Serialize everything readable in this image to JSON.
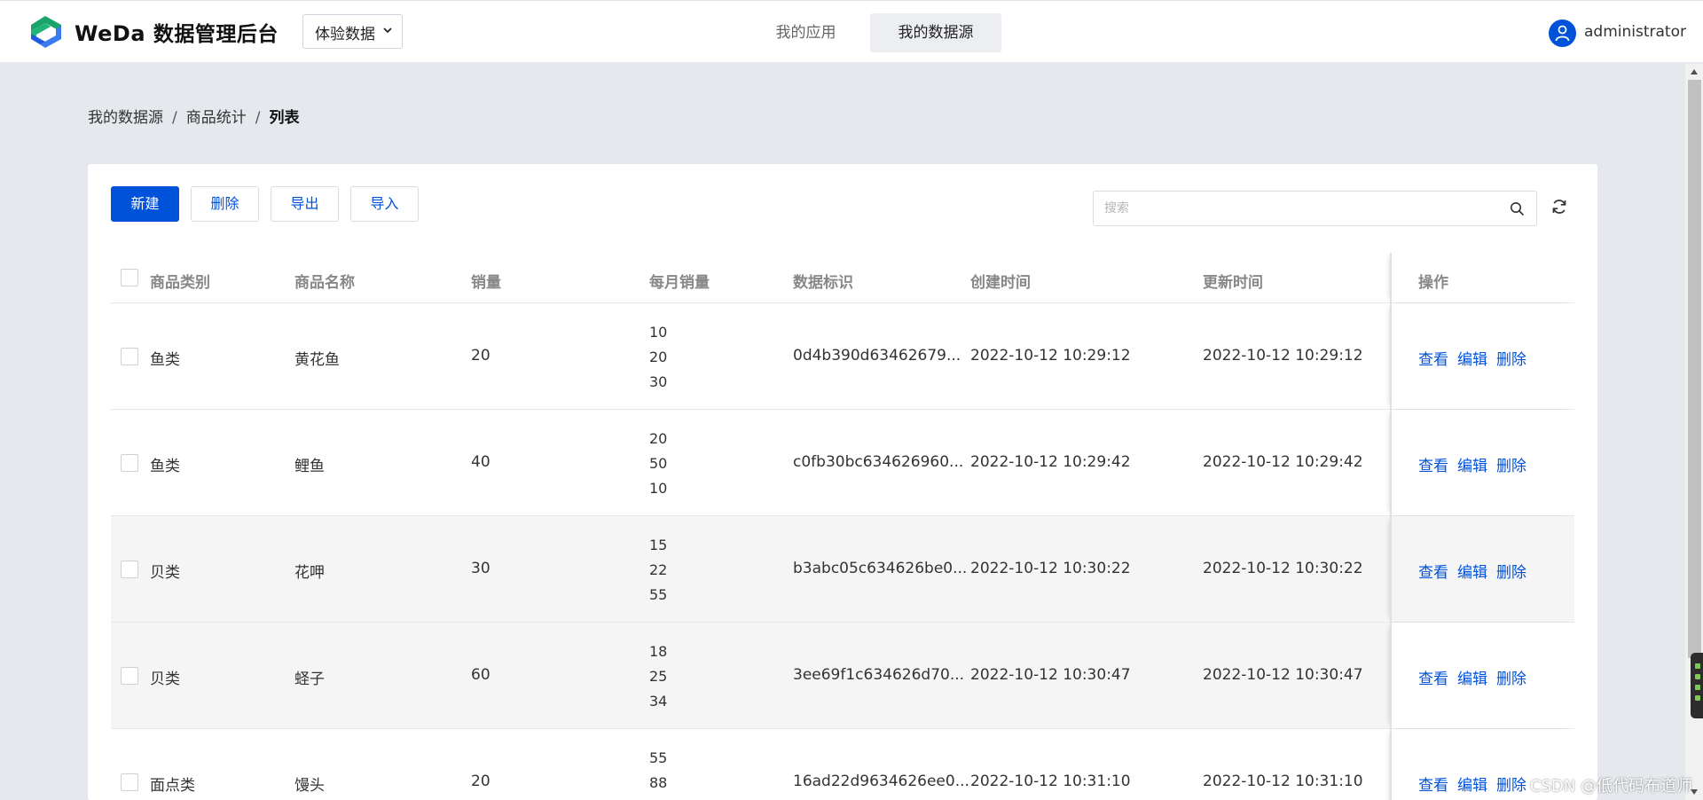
{
  "header": {
    "brand": "WeDa",
    "brand_sub": "数据管理后台",
    "env_select": "体验数据",
    "tabs": [
      {
        "label": "我的应用",
        "active": false
      },
      {
        "label": "我的数据源",
        "active": true
      }
    ],
    "user": "administrator"
  },
  "breadcrumb": [
    "我的数据源",
    "商品统计",
    "列表"
  ],
  "toolbar": {
    "new_label": "新建",
    "delete_label": "删除",
    "export_label": "导出",
    "import_label": "导入",
    "search_placeholder": "搜索"
  },
  "table": {
    "columns": [
      "商品类别",
      "商品名称",
      "销量",
      "每月销量",
      "数据标识",
      "创建时间",
      "更新时间",
      "操作"
    ],
    "rows": [
      {
        "category": "鱼类",
        "name": "黄花鱼",
        "sales": "20",
        "monthly": [
          "10",
          "20",
          "30"
        ],
        "id": "0d4b390d63462679...",
        "created": "2022-10-12 10:29:12",
        "updated": "2022-10-12 10:29:12"
      },
      {
        "category": "鱼类",
        "name": "鲤鱼",
        "sales": "40",
        "monthly": [
          "20",
          "50",
          "10"
        ],
        "id": "c0fb30bc634626960...",
        "created": "2022-10-12 10:29:42",
        "updated": "2022-10-12 10:29:42"
      },
      {
        "category": "贝类",
        "name": "花呷",
        "sales": "30",
        "monthly": [
          "15",
          "22",
          "55"
        ],
        "id": "b3abc05c634626be0...",
        "created": "2022-10-12 10:30:22",
        "updated": "2022-10-12 10:30:22"
      },
      {
        "category": "贝类",
        "name": "蛏子",
        "sales": "60",
        "monthly": [
          "18",
          "25",
          "34"
        ],
        "id": "3ee69f1c634626d70...",
        "created": "2022-10-12 10:30:47",
        "updated": "2022-10-12 10:30:47"
      },
      {
        "category": "面点类",
        "name": "馒头",
        "sales": "20",
        "monthly": [
          "55",
          "88",
          ""
        ],
        "id": "16ad22d9634626ee0...",
        "created": "2022-10-12 10:31:10",
        "updated": "2022-10-12 10:31:10"
      }
    ],
    "actions": {
      "view": "查看",
      "edit": "编辑",
      "delete": "删除"
    }
  },
  "watermark": "CSDN @低代码布道师",
  "colors": {
    "primary": "#0052d9",
    "page_bg": "#e5e8ed",
    "alt_row": "#f5f5f5"
  }
}
